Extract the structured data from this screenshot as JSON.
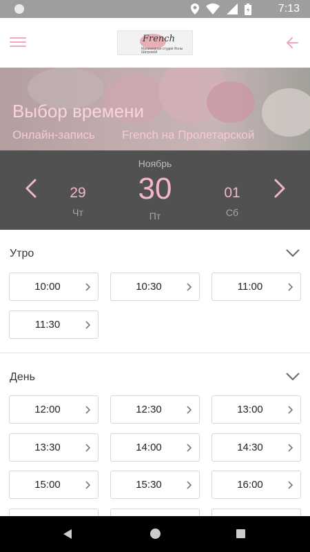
{
  "status_bar": {
    "time": "7:13",
    "icons": [
      "location-icon",
      "wifi-icon",
      "signal-icon",
      "battery-icon"
    ]
  },
  "app_bar": {
    "logo": {
      "script": "French",
      "subtitle": "Маникюрная студия Ясны Шатровой"
    }
  },
  "hero": {
    "title": "Выбор времени",
    "breadcrumb": [
      "Онлайн-запись",
      "French на Пролетарской"
    ]
  },
  "date_picker": {
    "month": "Ноябрь",
    "days": [
      {
        "number": "29",
        "weekday": "Чт"
      },
      {
        "number": "30",
        "weekday": "Пт"
      },
      {
        "number": "01",
        "weekday": "Сб"
      }
    ]
  },
  "sections": [
    {
      "title": "Утро",
      "slots": [
        "10:00",
        "10:30",
        "11:00",
        "11:30"
      ]
    },
    {
      "title": "День",
      "slots": [
        "12:00",
        "12:30",
        "13:00",
        "13:30",
        "14:00",
        "14:30",
        "15:00",
        "15:30",
        "16:00"
      ]
    }
  ],
  "colors": {
    "accent": "#f3b7cb",
    "dark_bar": "#525151",
    "status_bar": "#9e9e9e"
  }
}
